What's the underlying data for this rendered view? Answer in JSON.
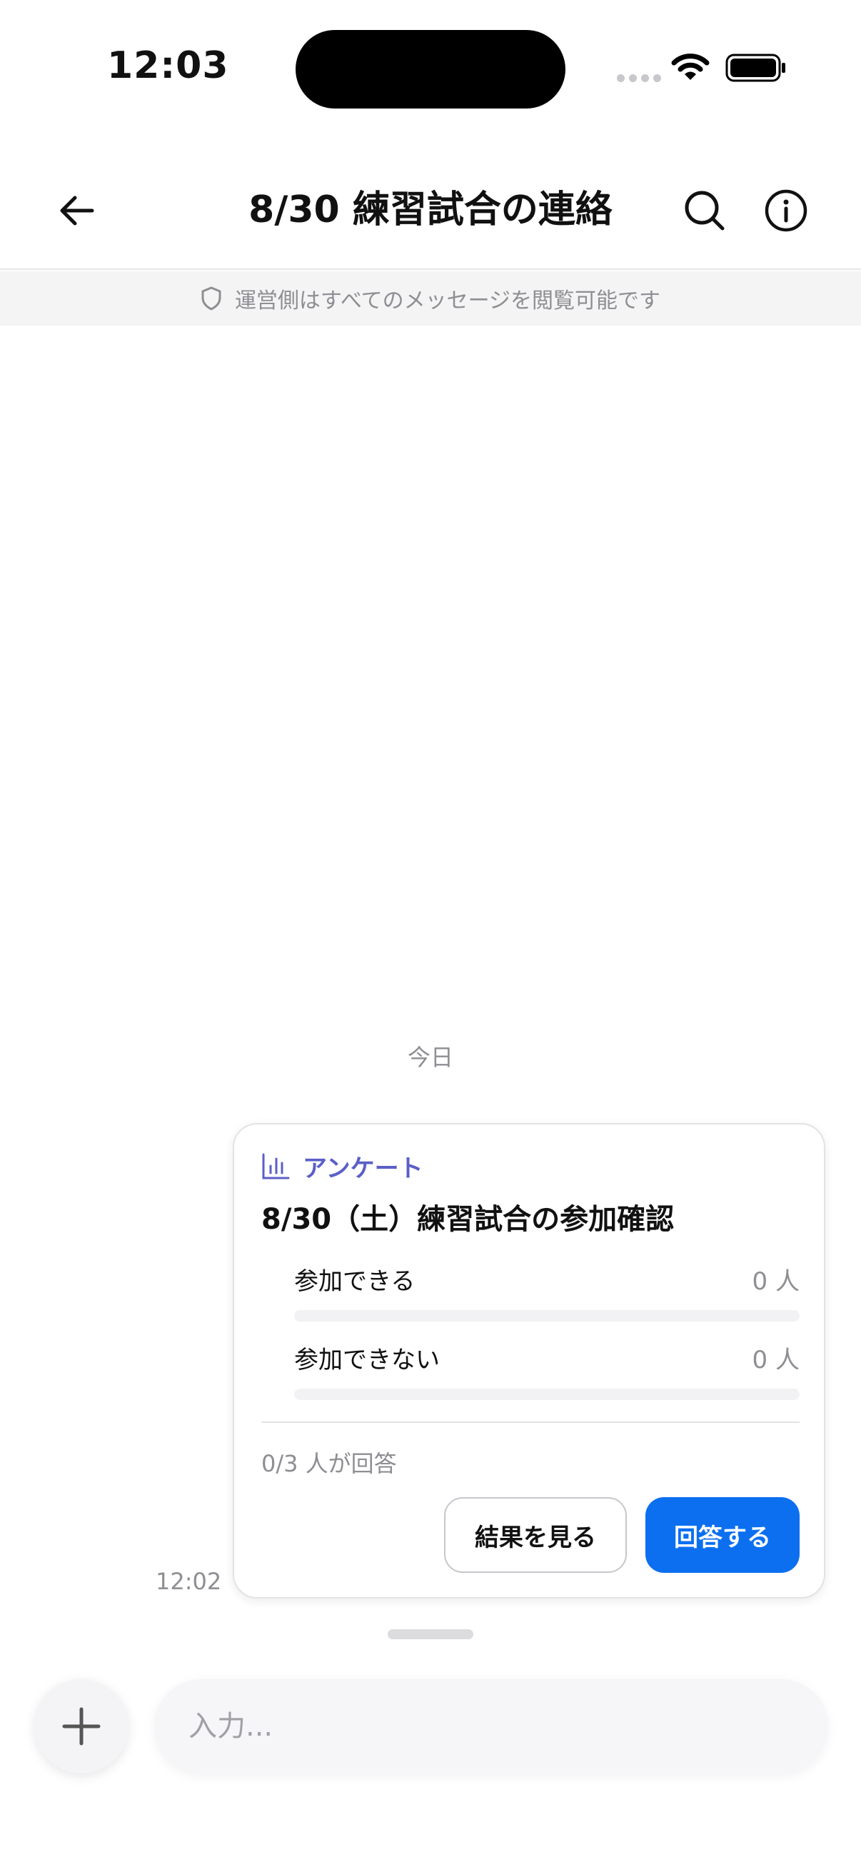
{
  "status_bar": {
    "time": "12:03"
  },
  "header": {
    "title": "8/30 練習試合の連絡"
  },
  "notice": {
    "text": "運営側はすべてのメッセージを閲覧可能です"
  },
  "chat": {
    "date_label": "今日",
    "message_time": "12:02"
  },
  "poll": {
    "type_label": "アンケート",
    "title": "8/30（土）練習試合の参加確認",
    "options": [
      {
        "label": "参加できる",
        "count": "0 人",
        "fraction": 0
      },
      {
        "label": "参加できない",
        "count": "0 人",
        "fraction": 0
      }
    ],
    "responded": "0/3 人が回答",
    "results_button": "結果を見る",
    "answer_button": "回答する"
  },
  "composer": {
    "placeholder": "入力..."
  },
  "colors": {
    "accent": "#0b6ff0",
    "poll_label": "#5b5fc7",
    "muted": "#8e8e93"
  }
}
